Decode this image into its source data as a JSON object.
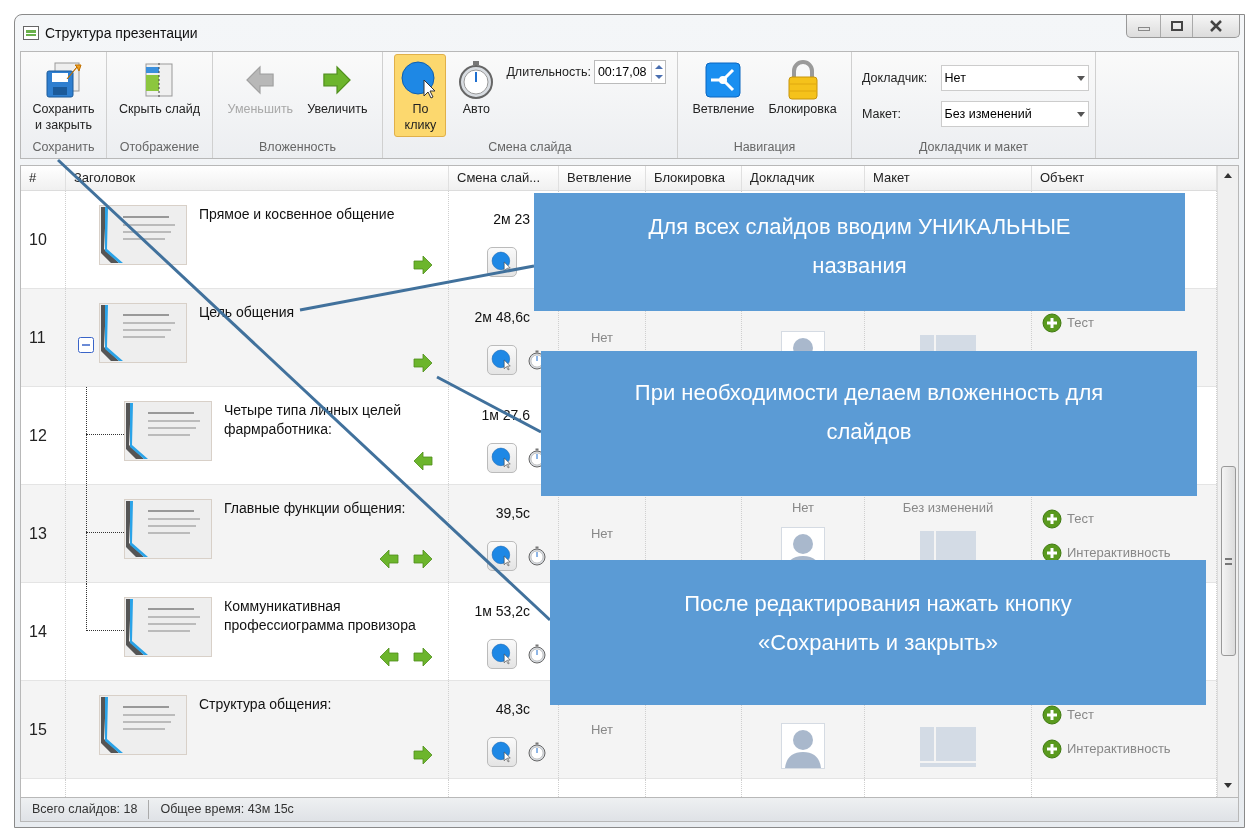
{
  "window": {
    "title": "Структура презентации"
  },
  "ribbon": {
    "groups": [
      {
        "label": "Сохранить",
        "buttons": [
          {
            "kind": "save",
            "label": "Сохранить и закрыть",
            "disabled": false,
            "selected": false
          }
        ]
      },
      {
        "label": "Отображение",
        "buttons": [
          {
            "kind": "hide",
            "label": "Скрыть слайд",
            "disabled": false,
            "selected": false
          }
        ]
      },
      {
        "label": "Вложенность",
        "buttons": [
          {
            "kind": "outdent",
            "label": "Уменьшить",
            "disabled": true,
            "selected": false
          },
          {
            "kind": "indent",
            "label": "Увеличить",
            "disabled": false,
            "selected": false
          }
        ]
      },
      {
        "label": "Смена слайда",
        "buttons": [
          {
            "kind": "click",
            "label": "По клику",
            "disabled": false,
            "selected": true
          },
          {
            "kind": "auto",
            "label": "Авто",
            "disabled": false,
            "selected": false
          }
        ],
        "fields": [
          {
            "kind": "spinner",
            "label": "Длительность:",
            "value": "00:17,08"
          }
        ]
      },
      {
        "label": "Навигация",
        "buttons": [
          {
            "kind": "branch",
            "label": "Ветвление",
            "disabled": false,
            "selected": false
          },
          {
            "kind": "lock",
            "label": "Блокировка",
            "disabled": false,
            "selected": false
          }
        ]
      },
      {
        "label": "Докладчик и макет",
        "fields": [
          {
            "kind": "dropdown",
            "label": "Докладчик:",
            "value": "Нет"
          },
          {
            "kind": "dropdown",
            "label": "Макет:",
            "value": "Без изменений"
          }
        ]
      }
    ]
  },
  "table": {
    "columns": [
      "#",
      "Заголовок",
      "Смена слай...",
      "Ветвление",
      "Блокировка",
      "Докладчик",
      "Макет",
      "Объект"
    ],
    "rows": [
      {
        "number": "10",
        "title": "Прямое и косвенное общение",
        "can_outdent": false,
        "can_indent": true,
        "time": "2м 23",
        "stopwatch": false
      },
      {
        "number": "11",
        "title": "Цель общения",
        "can_outdent": false,
        "can_indent": true,
        "expanded": true,
        "time": "2м 48,6с",
        "stopwatch": true,
        "branch": "Нет",
        "speaker": {
          "avatar": true
        },
        "layout": {
          "preview": true
        },
        "objects": [
          "Тест"
        ],
        "children": [
          {
            "number": "12",
            "title": "Четыре типа личных целей фармработника:",
            "can_outdent": true,
            "can_indent": false,
            "time": "1м 27,6",
            "stopwatch": true
          },
          {
            "number": "13",
            "title": "Главные функции общения:",
            "can_outdent": true,
            "can_indent": true,
            "time": "39,5с",
            "stopwatch": true,
            "branch": "Нет",
            "speaker": {
              "label": "Нет",
              "avatar": true
            },
            "layout": {
              "label": "Без изменений",
              "preview": true
            },
            "objects": [
              "Тест",
              "Интерактивность"
            ]
          },
          {
            "number": "14",
            "title": "Коммуникативная профессиограмма провизора",
            "can_outdent": true,
            "can_indent": true,
            "time": "1м 53,2с",
            "stopwatch": true
          }
        ]
      },
      {
        "number": "15",
        "title": "Структура общения:",
        "can_outdent": false,
        "can_indent": true,
        "time": "48,3с",
        "stopwatch": true,
        "branch": "Нет",
        "speaker": {
          "avatar": true
        },
        "layout": {
          "preview": true
        },
        "objects": [
          "Тест",
          "Интерактивность"
        ]
      }
    ]
  },
  "status_bar": [
    "Всего слайдов: 18",
    "Общее время: 43м 15с"
  ],
  "callouts": [
    {
      "text": "Для всех слайдов вводим УНИКАЛЬНЫЕ названия"
    },
    {
      "text": "При необходимости делаем вложенность для слайдов"
    },
    {
      "text": "После редактирования нажать кнопку «Сохранить и закрыть»"
    }
  ]
}
